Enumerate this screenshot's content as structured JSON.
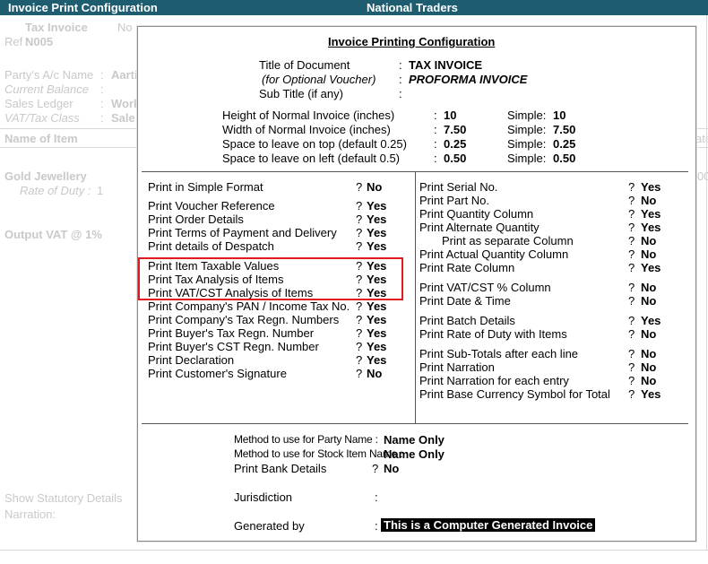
{
  "window": {
    "title": "Invoice Print Configuration",
    "company": "National Traders"
  },
  "background": {
    "voucher_type": "Tax Invoice",
    "no_label": "No",
    "ref_label": "Ref :",
    "ref_value": "N005",
    "party_label": "Party's A/c Name",
    "party_value": "Aarti",
    "current_balance_label": "Current Balance",
    "sales_ledger_label": "Sales Ledger",
    "sales_ledger_value": "Work",
    "vat_class_label": "VAT/Tax Class",
    "vat_class_value": "Sale",
    "name_of_item_label": "Name of Item",
    "item_name": "Gold Jewellery",
    "rate_of_duty_label": "Rate of Duty :",
    "rate_of_duty_value": "1",
    "output_vat_label": "Output VAT @ 1%",
    "show_statutory_label": "Show Statutory Details",
    "narration_label": "Narration:",
    "right_cut_1": "ate",
    "right_cut_2": "00"
  },
  "dialog": {
    "title": "Invoice Printing Configuration",
    "header": {
      "title_of_document_label": "Title of Document",
      "title_of_document_value": "TAX INVOICE",
      "optional_voucher_label": "(for Optional Voucher)",
      "optional_voucher_value": "PROFORMA INVOICE",
      "subtitle_label": "Sub Title (if any)",
      "colon": ":"
    },
    "dimensions": [
      {
        "label": "Height of Normal Invoice (inches)",
        "value": "10",
        "simple_label": "Simple:",
        "simple_value": "10"
      },
      {
        "label": "Width of Normal Invoice (inches)",
        "value": "7.50",
        "simple_label": "Simple:",
        "simple_value": "7.50"
      },
      {
        "label": "Space to leave on top (default 0.25)",
        "value": "0.25",
        "simple_label": "Simple:",
        "simple_value": "0.25"
      },
      {
        "label": "Space to leave on left (default 0.5)",
        "value": "0.50",
        "simple_label": "Simple:",
        "simple_value": "0.50"
      }
    ],
    "left_options": [
      {
        "label": "Print in Simple Format",
        "value": "No"
      },
      {
        "label": "Print Voucher Reference",
        "value": "Yes"
      },
      {
        "label": "Print Order Details",
        "value": "Yes"
      },
      {
        "label": "Print Terms of Payment and Delivery",
        "value": "Yes"
      },
      {
        "label": "Print details of Despatch",
        "value": "Yes"
      },
      {
        "label": "Print Item Taxable Values",
        "value": "Yes"
      },
      {
        "label": "Print Tax Analysis of Items",
        "value": "Yes"
      },
      {
        "label": "Print VAT/CST Analysis of Items",
        "value": "Yes"
      },
      {
        "label": "Print Company's PAN / Income Tax No.",
        "value": "Yes"
      },
      {
        "label": "Print Company's Tax Regn. Numbers",
        "value": "Yes"
      },
      {
        "label": "Print Buyer's Tax Regn. Number",
        "value": "Yes"
      },
      {
        "label": "Print Buyer's CST Regn. Number",
        "value": "Yes"
      },
      {
        "label": "Print Declaration",
        "value": "Yes"
      },
      {
        "label": "Print Customer's Signature",
        "value": "No"
      }
    ],
    "right_options": [
      {
        "label": "Print Serial No.",
        "value": "Yes"
      },
      {
        "label": "Print Part No.",
        "value": "No"
      },
      {
        "label": "Print Quantity Column",
        "value": "Yes"
      },
      {
        "label": "Print Alternate Quantity",
        "value": "Yes"
      },
      {
        "label": "Print as separate Column",
        "value": "No"
      },
      {
        "label": "Print Actual Quantity Column",
        "value": "No"
      },
      {
        "label": "Print Rate Column",
        "value": "Yes"
      },
      {
        "label": "Print VAT/CST % Column",
        "value": "No"
      },
      {
        "label": "Print Date & Time",
        "value": "No"
      },
      {
        "label": "Print Batch Details",
        "value": "Yes"
      },
      {
        "label": "Print Rate of Duty with Items",
        "value": "No"
      },
      {
        "label": "Print Sub-Totals after each line",
        "value": "No"
      },
      {
        "label": "Print Narration",
        "value": "No"
      },
      {
        "label": "Print Narration for each entry",
        "value": "No"
      },
      {
        "label": "Print Base Currency Symbol for Total",
        "value": "Yes"
      }
    ],
    "question": "?",
    "footer": {
      "party_method_label": "Method to use for Party Name :",
      "party_method_value": "Name Only",
      "stock_method_label": "Method to use for Stock Item Name :",
      "stock_method_value": "Name Only",
      "bank_label": "Print Bank Details",
      "bank_value": "No",
      "jurisdiction_label": "Jurisdiction",
      "generated_label": "Generated by",
      "generated_value": "This is a Computer Generated Invoice",
      "colon": ":"
    },
    "colors": {
      "title_bar": "#1e5c70",
      "highlight_border": "#e0191f"
    }
  }
}
